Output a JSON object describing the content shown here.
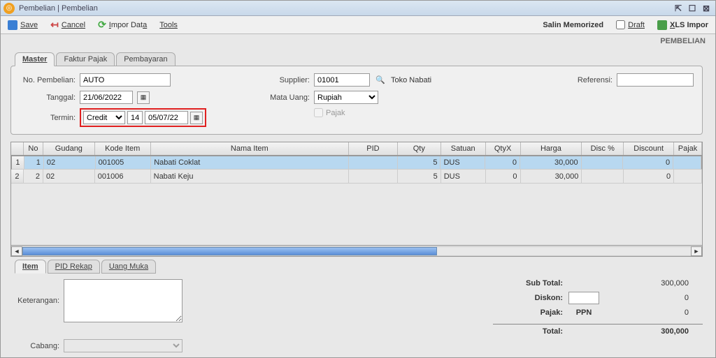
{
  "window": {
    "title": "Pembelian | Pembelian"
  },
  "toolbar": {
    "save": "Save",
    "cancel": "Cancel",
    "impor_data": "Impor Data",
    "tools": "Tools",
    "salin_memorized": "Salin Memorized",
    "draft": "Draft",
    "xls_impor": "XLS Impor"
  },
  "page_label": "PEMBELIAN",
  "tabs": {
    "master": "Master",
    "faktur_pajak": "Faktur Pajak",
    "pembayaran": "Pembayaran"
  },
  "header": {
    "labels": {
      "no_pembelian": "No. Pembelian:",
      "tanggal": "Tanggal:",
      "termin": "Termin:",
      "supplier": "Supplier:",
      "mata_uang": "Mata Uang:",
      "pajak": "Pajak",
      "referensi": "Referensi:"
    },
    "no_pembelian": "AUTO",
    "tanggal": "21/06/2022",
    "termin_type": "Credit",
    "termin_days": "14",
    "termin_date": "05/07/22",
    "supplier_code": "01001",
    "supplier_name": "Toko Nabati",
    "mata_uang": "Rupiah",
    "referensi": ""
  },
  "grid": {
    "headers": {
      "no": "No",
      "gudang": "Gudang",
      "kode_item": "Kode Item",
      "nama_item": "Nama Item",
      "pid": "PID",
      "qty": "Qty",
      "satuan": "Satuan",
      "qtyx": "QtyX",
      "harga": "Harga",
      "disc_pct": "Disc %",
      "discount": "Discount",
      "pajak": "Pajak"
    },
    "rows": [
      {
        "rownum": "1",
        "no": "1",
        "gudang": "02",
        "kode_item": "001005",
        "nama_item": "Nabati Coklat",
        "pid": "",
        "qty": "5",
        "satuan": "DUS",
        "qtyx": "0",
        "harga": "30,000",
        "disc_pct": "",
        "discount": "0",
        "pajak": ""
      },
      {
        "rownum": "2",
        "no": "2",
        "gudang": "02",
        "kode_item": "001006",
        "nama_item": "Nabati Keju",
        "pid": "",
        "qty": "5",
        "satuan": "DUS",
        "qtyx": "0",
        "harga": "30,000",
        "disc_pct": "",
        "discount": "0",
        "pajak": ""
      }
    ]
  },
  "lower_tabs": {
    "item": "Item",
    "pid_rekap": "PID Rekap",
    "uang_muka": "Uang Muka"
  },
  "footer": {
    "labels": {
      "keterangan": "Keterangan:",
      "cabang": "Cabang:",
      "sub_total": "Sub Total:",
      "diskon": "Diskon:",
      "pajak": "Pajak:",
      "total": "Total:"
    },
    "keterangan": "",
    "cabang": "",
    "sub_total": "300,000",
    "diskon_input": "",
    "diskon_val": "0",
    "pajak_name": "PPN",
    "pajak_val": "0",
    "total": "300,000"
  }
}
